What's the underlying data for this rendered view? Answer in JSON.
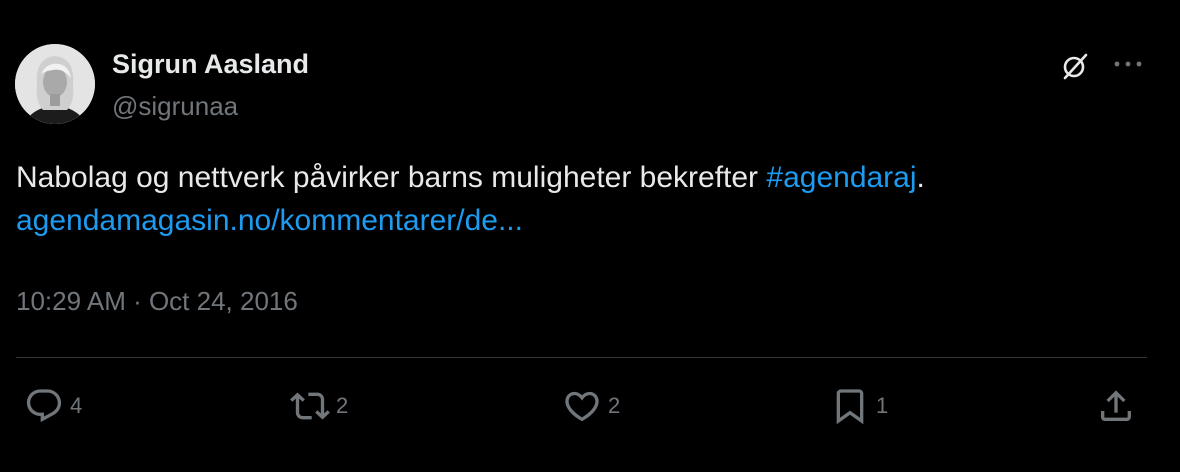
{
  "author": {
    "display_name": "Sigrun Aasland",
    "handle": "@sigrunaa",
    "avatar_icon": "profile-photo"
  },
  "header_actions": {
    "grok_icon": "grok-icon",
    "more_icon": "more-icon",
    "more_label": "···"
  },
  "tweet": {
    "text_plain": "Nabolag og nettverk påvirker barns muligheter bekrefter ",
    "hashtag": "#agendaraj",
    "text_after_hashtag": ".",
    "link": "agendamagasin.no/kommentarer/de..."
  },
  "timestamp": "10:29 AM · Oct 24, 2016",
  "actions": {
    "reply": {
      "icon": "reply-icon",
      "count": "4"
    },
    "retweet": {
      "icon": "retweet-icon",
      "count": "2"
    },
    "like": {
      "icon": "heart-icon",
      "count": "2"
    },
    "bookmark": {
      "icon": "bookmark-icon",
      "count": "1"
    },
    "share": {
      "icon": "share-icon"
    }
  },
  "colors": {
    "background": "#000000",
    "primary_text": "#e7e9ea",
    "secondary_text": "#71767b",
    "link": "#1d9bf0",
    "divider": "#2f3336"
  }
}
